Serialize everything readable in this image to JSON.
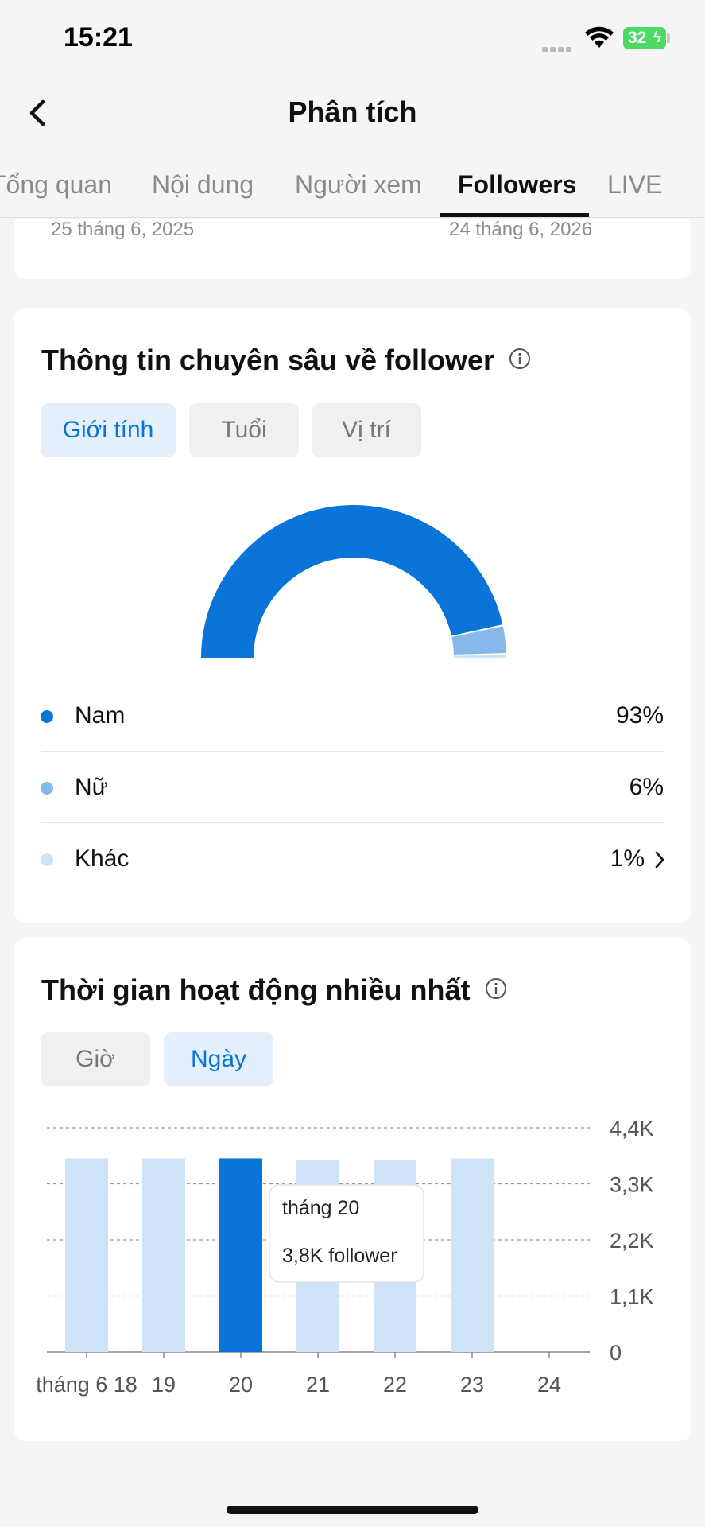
{
  "status_bar": {
    "time": "15:21",
    "battery": "32"
  },
  "header": {
    "title": "Phân tích"
  },
  "tabs": [
    {
      "label": "Tổng quan"
    },
    {
      "label": "Nội dung"
    },
    {
      "label": "Người xem"
    },
    {
      "label": "Followers",
      "active": true
    },
    {
      "label": "LIVE"
    }
  ],
  "date_range": {
    "start": "25 tháng 6, 2025",
    "end": "24 tháng 6, 2026"
  },
  "follower_insights": {
    "title": "Thông tin chuyên sâu về follower",
    "filters": [
      {
        "label": "Giới tính",
        "active": true
      },
      {
        "label": "Tuổi",
        "active": false
      },
      {
        "label": "Vị trí",
        "active": false
      }
    ],
    "legend": [
      {
        "label": "Nam",
        "value": "93%",
        "color": "#0a74d9"
      },
      {
        "label": "Nữ",
        "value": "6%",
        "color": "#85b9ea"
      },
      {
        "label": "Khác",
        "value": "1%",
        "color": "#cfe3f8"
      }
    ]
  },
  "most_active": {
    "title": "Thời gian hoạt động nhiều nhất",
    "filters": [
      {
        "label": "Giờ",
        "active": false
      },
      {
        "label": "Ngày",
        "active": true
      }
    ],
    "tooltip": {
      "title": "tháng 20",
      "value": "3,8K follower"
    }
  },
  "chart_data": [
    {
      "type": "pie",
      "categories": [
        "Nam",
        "Nữ",
        "Khác"
      ],
      "values": [
        93,
        6,
        1
      ],
      "colors": [
        "#0a74d9",
        "#85b9ea",
        "#cfe3f8"
      ],
      "half_donut": true
    },
    {
      "type": "bar",
      "categories": [
        "tháng 6 18",
        "19",
        "20",
        "21",
        "22",
        "23",
        "24"
      ],
      "values": [
        3800,
        3800,
        3800,
        3770,
        3770,
        3800,
        0
      ],
      "highlight_index": 2,
      "y_ticks": [
        "0",
        "1,1K",
        "2,2K",
        "3,3K",
        "4,4K"
      ],
      "ylim": [
        0,
        4400
      ],
      "grid": true,
      "colors": {
        "bar": "#cfe3f8",
        "highlight": "#0a74d9"
      }
    }
  ]
}
